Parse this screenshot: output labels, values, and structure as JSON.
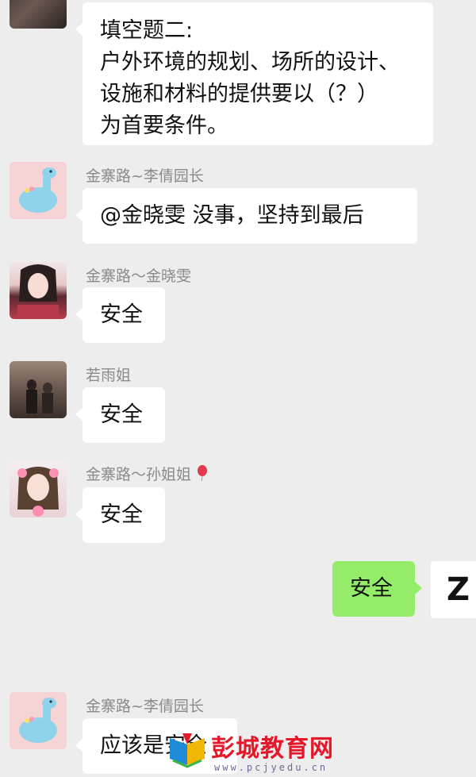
{
  "messages": [
    {
      "lines": [
        "填空题二:",
        "户外环境的规划、场所的设计、",
        "设施和材料的提供要以（？）",
        "为首要条件。"
      ]
    },
    {
      "sender": "金寨路~李倩园长",
      "text": "@金晓雯  没事，坚持到最后"
    },
    {
      "sender": "金寨路～金晓雯",
      "text": "安全"
    },
    {
      "sender": "若雨姐",
      "text": "安全"
    },
    {
      "sender": "金寨路～孙姐姐",
      "text": "安全"
    },
    {
      "sender": "金寨路~李倩园长",
      "text": "应该是安全"
    }
  ],
  "self_message": {
    "text": "安全",
    "avatar_letter": "Z"
  },
  "watermark": {
    "title": "彭城教育网",
    "url": "www.pcjyedu.cn"
  },
  "colors": {
    "background": "#ededed",
    "bubble": "#ffffff",
    "self_bubble": "#95ec69",
    "watermark": "#e5182a"
  }
}
